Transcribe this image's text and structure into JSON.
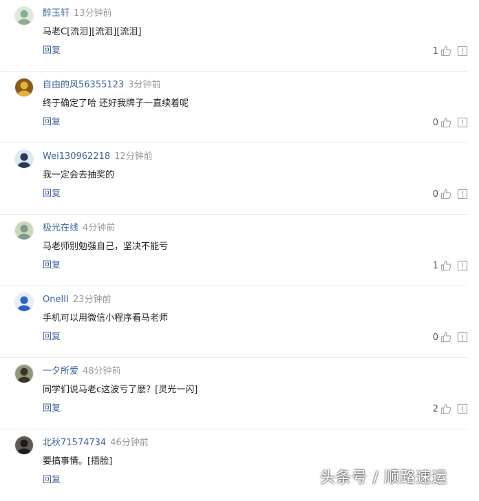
{
  "comments": [
    {
      "username": "醉玉轩",
      "time": "13分钟前",
      "text": "马老C[流泪][流泪][流泪]",
      "reply": "回复",
      "likes": "1",
      "avatar": {
        "icon": "avatar-icon",
        "bg": "#dfe9df",
        "fg": "#8fae8f"
      }
    },
    {
      "username": "自由的风56355123",
      "time": "3分钟前",
      "text": "终于确定了哈 还好我牌子一直续着呢",
      "reply": "回复",
      "likes": "0",
      "avatar": {
        "icon": "avatar-icon",
        "bg": "#8a5a1a",
        "fg": "#e3b23c"
      }
    },
    {
      "username": "Wei130962218",
      "time": "12分钟前",
      "text": "我一定会去抽奖的",
      "reply": "回复",
      "likes": "0",
      "avatar": {
        "icon": "avatar-icon",
        "bg": "#dfe8f2",
        "fg": "#2b3b55"
      }
    },
    {
      "username": "极光在线",
      "time": "4分钟前",
      "text": "马老师别勉强自己，坚决不能亏",
      "reply": "回复",
      "likes": "1",
      "avatar": {
        "icon": "avatar-icon",
        "bg": "#c9d8b9",
        "fg": "#7d9a8e"
      }
    },
    {
      "username": "OneIII",
      "time": "23分钟前",
      "text": "手机可以用微信小程序看马老师",
      "reply": "回复",
      "likes": "0",
      "avatar": {
        "icon": "avatar-icon",
        "bg": "#e8eef8",
        "fg": "#2a62c9"
      }
    },
    {
      "username": "一夕所爱",
      "time": "48分钟前",
      "text": "同学们说马老c这波亏了麽？[灵光一闪]",
      "reply": "回复",
      "likes": "2",
      "avatar": {
        "icon": "avatar-icon",
        "bg": "#8f9a7c",
        "fg": "#3b3528"
      }
    },
    {
      "username": "北秋71574734",
      "time": "46分钟前",
      "text": "要搞事情。[捂脸]",
      "reply": "回复",
      "likes": "",
      "avatar": {
        "icon": "avatar-icon",
        "bg": "#5e5a55",
        "fg": "#1e1c1a"
      }
    }
  ],
  "icons": {
    "like": "thumbs-up-icon",
    "report": "report-icon"
  },
  "colors": {
    "link": "#406599",
    "muted": "#999999",
    "text": "#222222",
    "divider": "#ebebeb"
  },
  "watermark": "头条号 / 顺路速运"
}
